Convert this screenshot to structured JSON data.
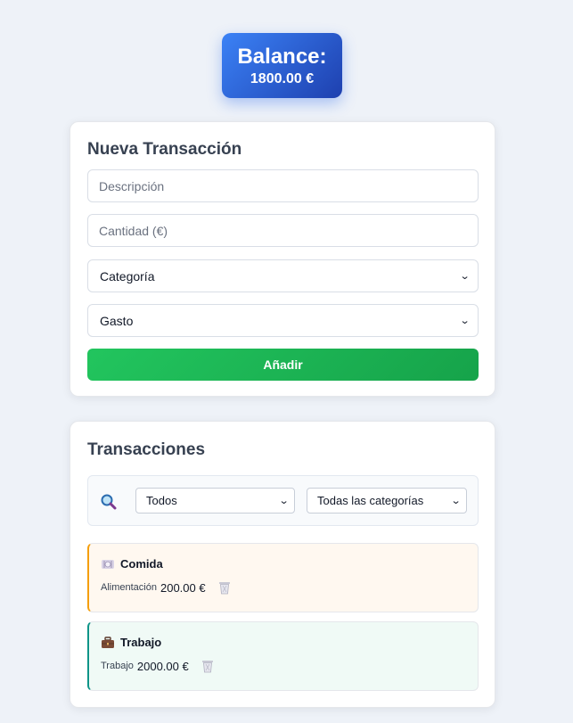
{
  "balance": {
    "title": "Balance:",
    "amount": "1800.00 €"
  },
  "form": {
    "title": "Nueva Transacción",
    "description_placeholder": "Descripción",
    "amount_placeholder": "Cantidad (€)",
    "category_select": "Categoría",
    "type_select": "Gasto",
    "add_button": "Añadir"
  },
  "list": {
    "title": "Transacciones",
    "filter_type": "Todos",
    "filter_category": "Todas las categorías",
    "transactions": [
      {
        "icon": "plate-icon",
        "name": "Comida",
        "category": "Alimentación",
        "amount": "200.00 €",
        "accent": "#f59e0b"
      },
      {
        "icon": "briefcase-icon",
        "name": "Trabajo",
        "category": "Trabajo",
        "amount": "2000.00 €",
        "accent": "#0d9488"
      }
    ]
  },
  "colors": {
    "primary": "#2563eb",
    "success": "#22c55e",
    "background": "#eef2f8"
  }
}
